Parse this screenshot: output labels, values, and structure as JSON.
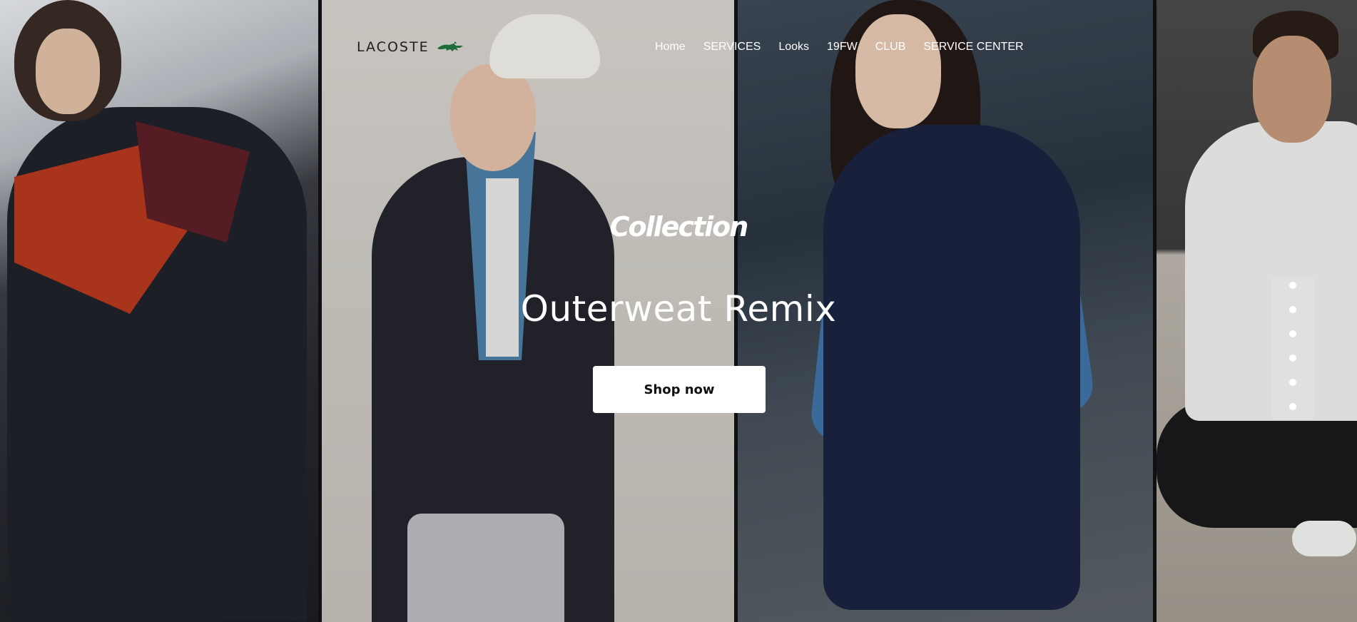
{
  "brand": {
    "name": "LACOSTE",
    "logo_icon": "crocodile-icon",
    "logo_color": "#1f6b3a"
  },
  "nav": {
    "items": [
      {
        "label": "Home"
      },
      {
        "label": "SERVICES"
      },
      {
        "label": "Looks"
      },
      {
        "label": "19FW"
      },
      {
        "label": "CLUB"
      },
      {
        "label": "SERVICE CENTER"
      }
    ]
  },
  "hero": {
    "eyebrow": "Collection",
    "title": "Outerweat Remix",
    "cta_label": "Shop now",
    "slide_count": 6
  }
}
